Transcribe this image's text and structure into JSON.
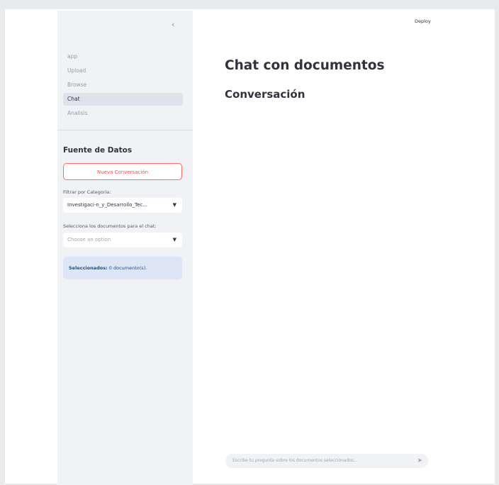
{
  "header": {
    "deploy_label": "Deploy"
  },
  "sidebar": {
    "collapse_icon": "chevron-left-icon",
    "nav": [
      {
        "label": "app",
        "active": false
      },
      {
        "label": "Upload",
        "active": false
      },
      {
        "label": "Browse",
        "active": false
      },
      {
        "label": "Chat",
        "active": true
      },
      {
        "label": "Analisis",
        "active": false
      }
    ],
    "section_title": "Fuente de Datos",
    "new_conversation_label": "Nueva Conversación",
    "filter_label": "Filtrar por Categoría:",
    "filter_value": "Investigaci-n_y_Desarrollo_Tec...",
    "docs_label": "Selecciona los documentos para el chat:",
    "docs_placeholder": "Choose an option",
    "selected_bold": "Seleccionados:",
    "selected_text": " 0 documento(s)."
  },
  "main": {
    "title": "Chat con documentos",
    "subtitle": "Conversación",
    "chat_placeholder": "Escribe tu pregunta sobre los documentos seleccionados...",
    "send_icon": "send-icon"
  }
}
